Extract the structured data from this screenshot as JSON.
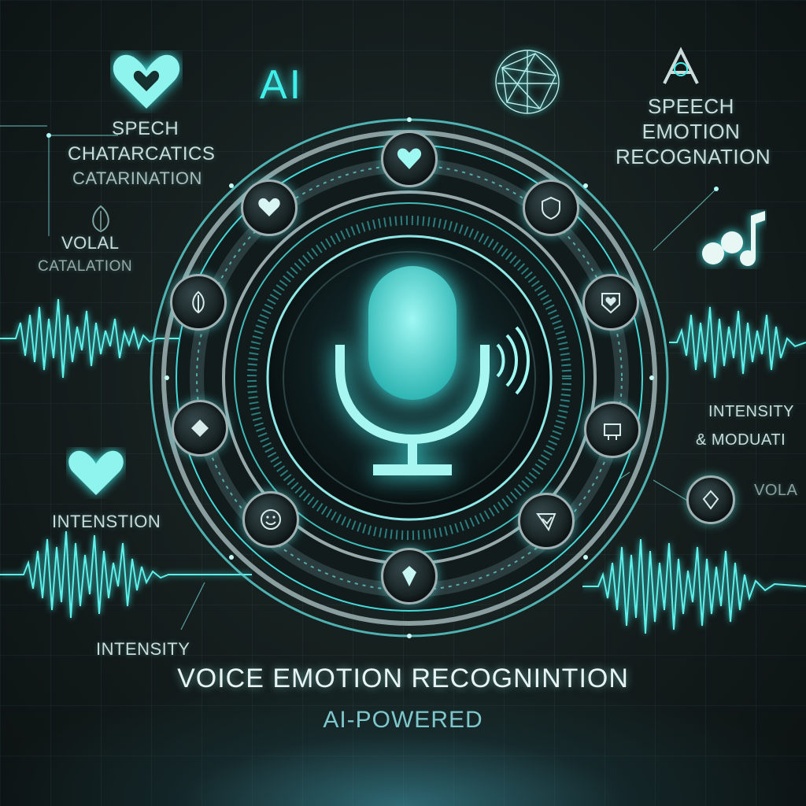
{
  "top": {
    "ai_label": "AI"
  },
  "left_labels": {
    "speech_characteristics_1": "SPECH",
    "speech_characteristics_2": "CHATARCATICS",
    "speech_characteristics_3": "CATARINATION",
    "vocal_1": "VOLAL",
    "vocal_2": "CATALATION",
    "intention": "INTENSTION",
    "intensity": "INTENSITY"
  },
  "right_labels": {
    "ser_1": "SPEECH",
    "ser_2": "EMOTION",
    "ser_3": "RECOGNATION",
    "intensity_1": "INTENSITY",
    "intensity_2": "& MODUATI",
    "vocal": "VOLA"
  },
  "bottom": {
    "title": "VOICE EMOTION RECOGNINTION",
    "subtitle": "AI-POWERED"
  },
  "icons": {
    "center": "microphone-icon",
    "nodes": [
      "heart-icon",
      "heart-icon",
      "shield-heart-icon",
      "heart-badge-icon",
      "device-icon",
      "shield-check-icon",
      "diamond-icon",
      "face-icon",
      "gem-icon",
      "leaf-icon"
    ],
    "side": [
      "heart-icon",
      "geodesic-sphere-icon",
      "ai-logo-icon",
      "music-note-icon",
      "heart-icon",
      "tag-icon"
    ]
  },
  "colors": {
    "accent": "#3ff0ea",
    "text": "#c9dcdc",
    "background": "#16201f"
  }
}
